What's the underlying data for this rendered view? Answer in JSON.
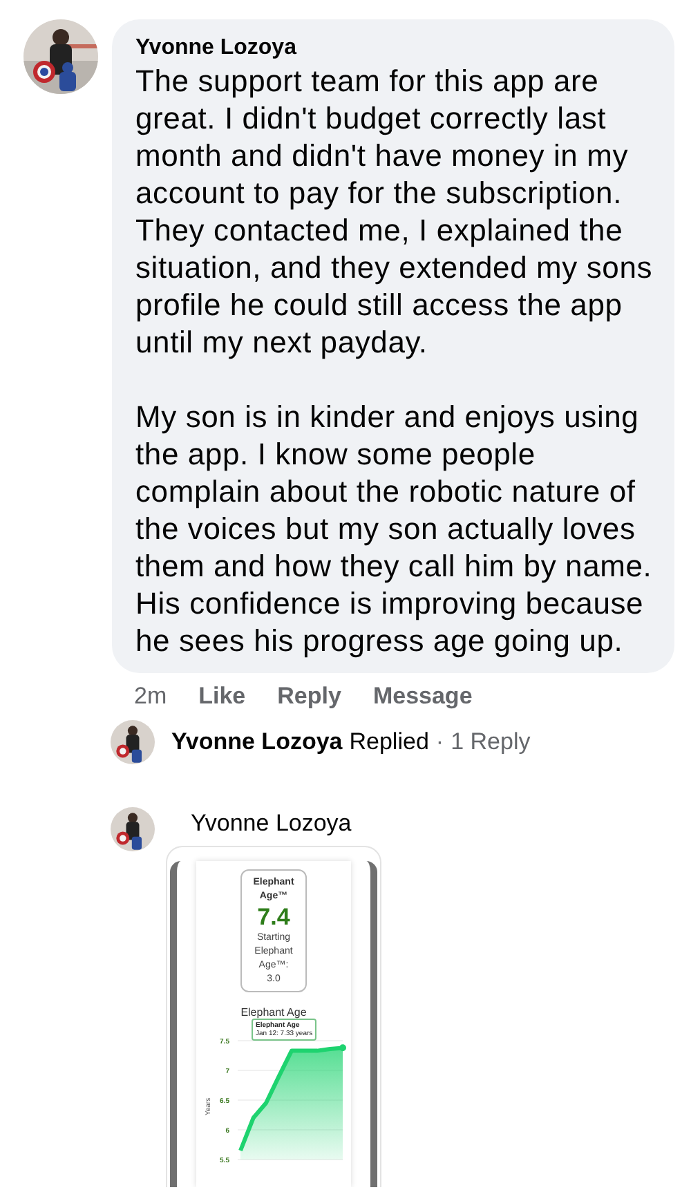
{
  "comment": {
    "author": "Yvonne Lozoya",
    "paragraphs": [
      "The support team for this app are great. I didn't budget correctly last month and didn't have money in my account to pay for the subscription. They contacted me, I explained the situation, and they extended my sons profile he could still access the app until my next payday.",
      "My son is in kinder and enjoys using the app. I know some people complain about the robotic nature of the voices but my son actually loves them and how they call him by name. His confidence is improving because he sees his progress age going up."
    ],
    "time": "2m",
    "actions": [
      "Like",
      "Reply",
      "Message"
    ]
  },
  "replies_summary": {
    "author": "Yvonne Lozoya",
    "verb": "Replied",
    "separator": "·",
    "count": "1 Reply"
  },
  "reply": {
    "author": "Yvonne Lozoya",
    "attachment": {
      "card": {
        "title": "Elephant Age™",
        "value": "7.4",
        "subtitle": "Starting Elephant Age™:",
        "start": "3.0"
      },
      "chart_data": {
        "type": "area",
        "title": "Elephant Age",
        "ylabel": "Years",
        "ylim": [
          5.5,
          7.5
        ],
        "yticks": [
          5.5,
          6,
          6.5,
          7,
          7.5
        ],
        "grid": true,
        "series": [
          {
            "name": "Elephant Age",
            "color": "#1ed36f",
            "values": [
              5.65,
              6.2,
              6.45,
              6.9,
              7.33,
              7.33,
              7.33,
              7.36,
              7.38
            ]
          }
        ],
        "annotations": [
          {
            "text": "Jan 12: 7.33 years"
          }
        ]
      }
    }
  }
}
